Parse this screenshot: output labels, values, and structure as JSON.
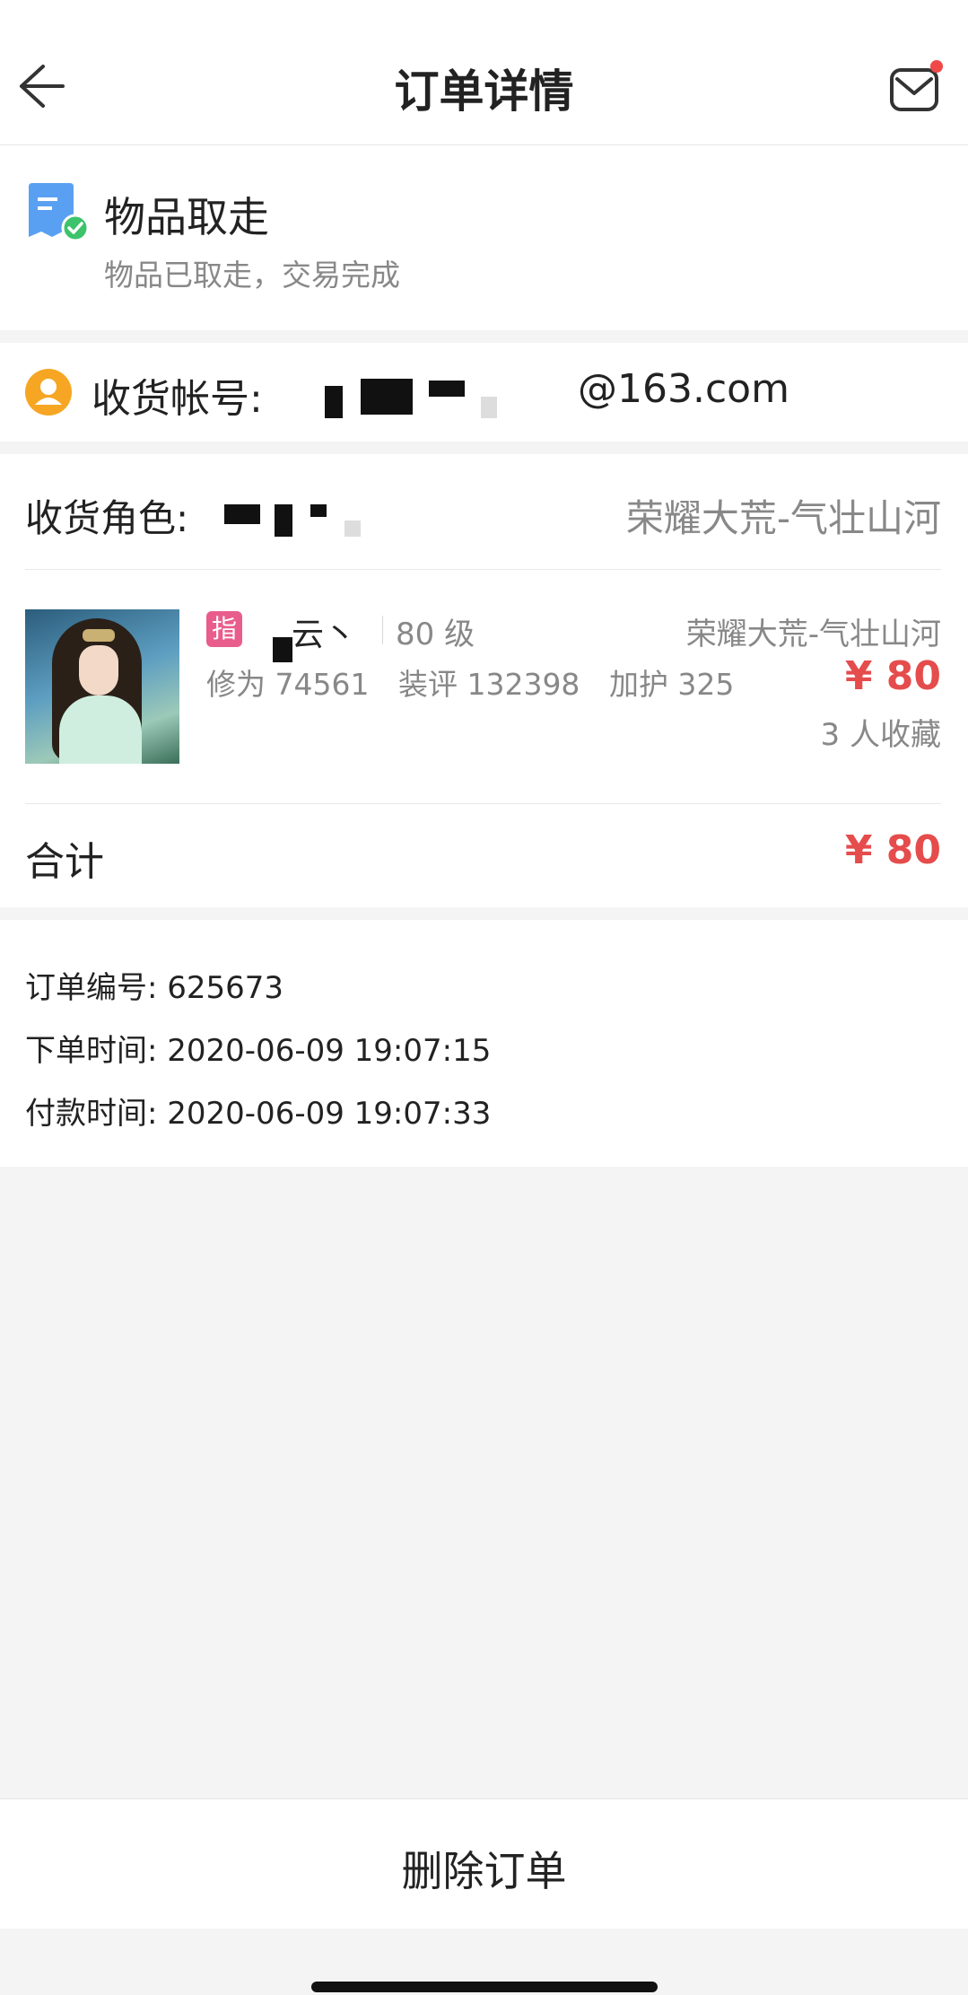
{
  "header": {
    "title": "订单详情",
    "back_icon": "arrow-left-icon",
    "mail_icon": "mail-icon"
  },
  "status": {
    "title": "物品取走",
    "subtitle": "物品已取走，交易完成"
  },
  "account": {
    "label": "收货帐号:",
    "value_suffix": "@163.com"
  },
  "order": {
    "role_label": "收货角色:",
    "role_server": "荣耀大荒-气壮山河",
    "item": {
      "tag": "指",
      "name": "云丶",
      "level": "80 级",
      "server": "荣耀大荒-气壮山河",
      "stats": [
        "修为 74561",
        "装评 132398",
        "加护 325"
      ],
      "price": "¥ 80",
      "favorites": "3 人收藏"
    },
    "total_label": "合计",
    "total_price": "¥ 80"
  },
  "info": {
    "order_no": "订单编号: 625673",
    "order_time": "下单时间: 2020-06-09 19:07:15",
    "pay_time": "付款时间: 2020-06-09 19:07:33"
  },
  "actions": {
    "delete_label": "删除订单"
  },
  "colors": {
    "price": "#e54c4c",
    "tag": "#e95d8c",
    "notification_dot": "#f04848"
  }
}
